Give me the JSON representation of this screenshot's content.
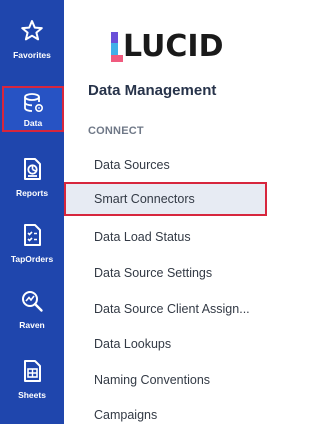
{
  "rail": {
    "items": [
      {
        "label": "Favorites",
        "icon": "star-icon"
      },
      {
        "label": "Data",
        "icon": "database-icon",
        "active": true
      },
      {
        "label": "Reports",
        "icon": "reports-icon"
      },
      {
        "label": "TapOrders",
        "icon": "checklist-icon"
      },
      {
        "label": "Raven",
        "icon": "raven-search-icon"
      },
      {
        "label": "Sheets",
        "icon": "sheets-icon"
      }
    ],
    "background": "#1f46ad",
    "highlight_color": "#d7263d"
  },
  "brand": {
    "name": "LUCID"
  },
  "panel": {
    "title": "Data Management",
    "group_label": "CONNECT",
    "items": [
      {
        "label": "Data Sources"
      },
      {
        "label": "Smart Connectors",
        "selected": true
      },
      {
        "label": "Data Load Status"
      },
      {
        "label": "Data Source Settings"
      },
      {
        "label": "Data Source Client Assign..."
      },
      {
        "label": "Data Lookups"
      },
      {
        "label": "Naming Conventions"
      },
      {
        "label": "Campaigns"
      }
    ]
  }
}
